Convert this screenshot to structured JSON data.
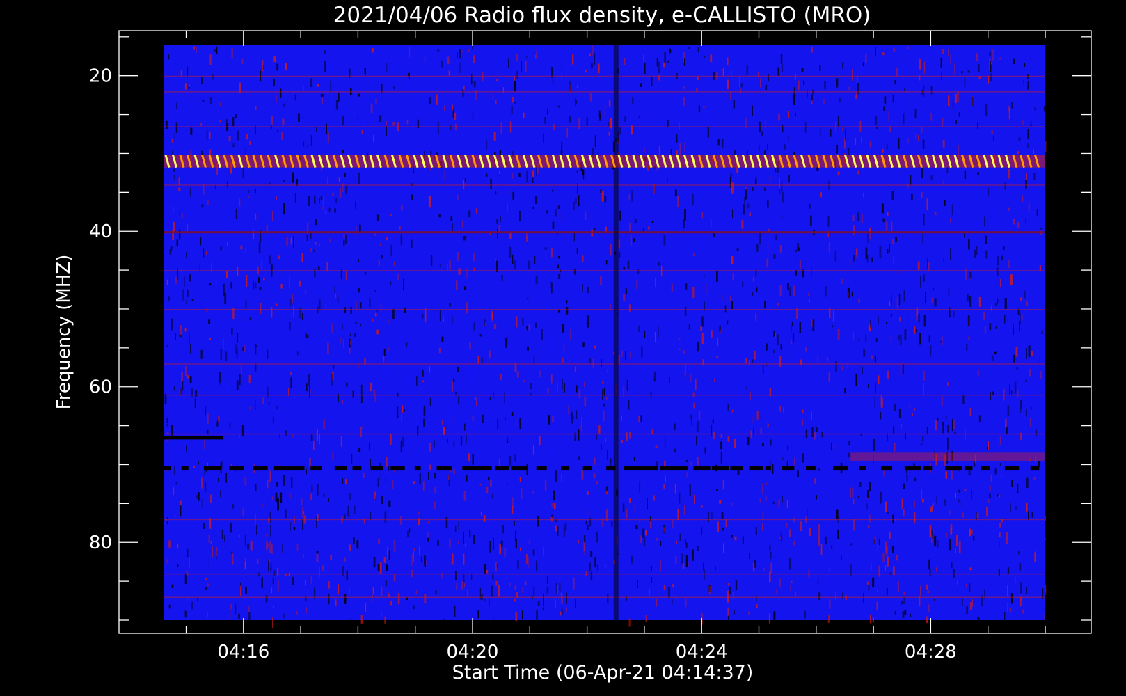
{
  "chart_data": {
    "type": "heatmap",
    "title": "2021/04/06  Radio flux density, e-CALLISTO (MRO)",
    "xlabel": "Start Time (06-Apr-21 04:14:37)",
    "ylabel": "Frequency (MHZ)",
    "x_ticks": [
      "04:16",
      "04:20",
      "04:24",
      "04:28"
    ],
    "x_tick_minutes": [
      16,
      20,
      24,
      28
    ],
    "x_range_minutes": [
      14.617,
      30.0
    ],
    "y_ticks": [
      20,
      40,
      60,
      80
    ],
    "y_range_mhz": [
      90,
      16
    ],
    "colormap": [
      "#000000",
      "#1414ff",
      "#d41c14",
      "#ff9c00",
      "#ffff60"
    ],
    "features": [
      {
        "name": "interference band",
        "freq_mhz": 31,
        "intensity": "high, periodic"
      },
      {
        "name": "narrow line",
        "freq_mhz": 40,
        "intensity": "low"
      },
      {
        "name": "data gap band",
        "freq_mhz": 70.5,
        "intensity": "dropouts"
      },
      {
        "name": "dark column",
        "time_minutes": 22.5,
        "intensity": "low"
      }
    ]
  }
}
